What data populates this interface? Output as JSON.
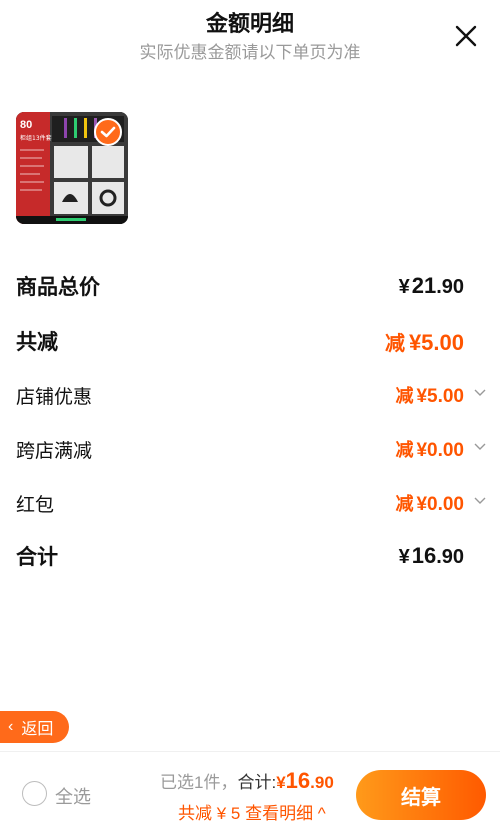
{
  "header": {
    "title": "金额明细",
    "subtitle": "实际优惠金额请以下单页为准"
  },
  "product": {
    "thumb_badge": "80",
    "thumb_caption": "柜组13件套"
  },
  "summary": {
    "goods_total_label": "商品总价",
    "goods_total_cur": "¥",
    "goods_total_int": "21",
    "goods_total_dec": ".90",
    "reduce_total_label": "共减",
    "reduce_total_prefix": "减",
    "reduce_total_value": "¥5.00",
    "shop_discount_label": "店铺优惠",
    "shop_discount_prefix": "减",
    "shop_discount_value": "¥5.00",
    "cross_shop_label": "跨店满减",
    "cross_shop_prefix": "减",
    "cross_shop_value": "¥0.00",
    "redpacket_label": "红包",
    "redpacket_prefix": "减",
    "redpacket_value": "¥0.00",
    "grand_total_label": "合计",
    "grand_total_cur": "¥",
    "grand_total_int": "16",
    "grand_total_dec": ".90"
  },
  "back_button": {
    "label": "返回"
  },
  "footer": {
    "select_all": "全选",
    "selected_count": "已选1件，",
    "total_label": "合计:",
    "total_cur": "¥",
    "total_int": "16",
    "total_dec": ".90",
    "reduce_detail": "共减 ¥ 5  查看明细 ^",
    "settle_label": "结算"
  },
  "colors": {
    "accent": "#ff5500",
    "button": "#ff6a1a"
  }
}
